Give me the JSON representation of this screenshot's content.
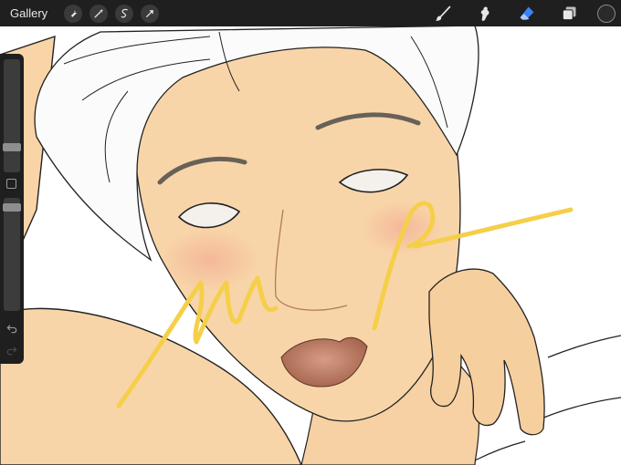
{
  "toolbar": {
    "gallery_label": "Gallery",
    "left_tools": [
      "wrench-icon",
      "magic-wand-icon",
      "selection-icon",
      "transform-arrow-icon"
    ],
    "right_tools": [
      "brush-icon",
      "smudge-icon",
      "eraser-icon",
      "layers-icon"
    ],
    "active_tool": "eraser",
    "active_color": "#2a2a2a",
    "accent": "#3b82f6"
  },
  "sidebar": {
    "brush_size": 0.2,
    "brush_opacity": 0.95,
    "controls": [
      "size-slider",
      "modify-button",
      "opacity-slider",
      "undo-button",
      "redo-button"
    ]
  },
  "canvas": {
    "overlay_text": "uip",
    "overlay_color": "#f5cf4a",
    "skin_color": "#f8d5a8"
  }
}
